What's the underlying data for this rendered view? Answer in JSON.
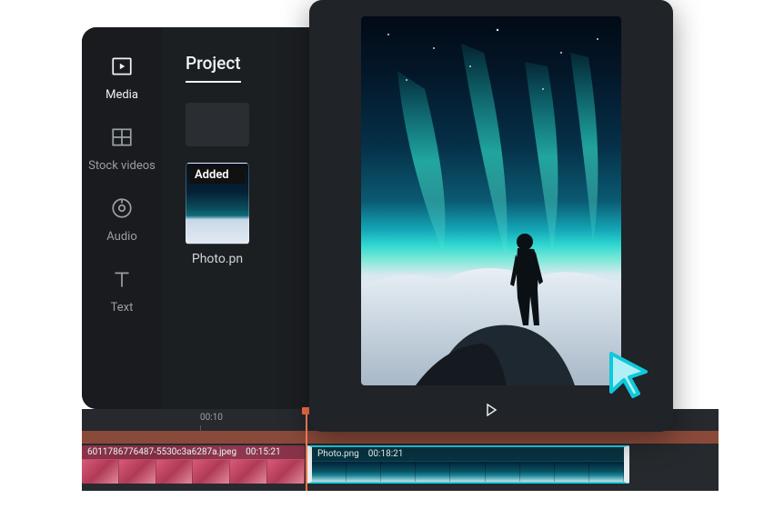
{
  "sidebar": {
    "items": [
      {
        "label": "Media",
        "icon": "media-icon",
        "active": true
      },
      {
        "label": "Stock videos",
        "icon": "stock-icon",
        "active": false
      },
      {
        "label": "Audio",
        "icon": "audio-icon",
        "active": false
      },
      {
        "label": "Text",
        "icon": "text-icon",
        "active": false
      }
    ]
  },
  "panel": {
    "tab_label": "Project",
    "added_badge": "Added",
    "thumb_filename": "Photo.pn"
  },
  "timeline": {
    "ticks": [
      "00:10"
    ],
    "clip_a": {
      "filename": "6011786776487-5530c3a6287a.jpeg",
      "duration": "00:15:21"
    },
    "clip_b": {
      "filename": "Photo.png",
      "duration": "00:18:21"
    }
  },
  "preview": {
    "play_label": "Play"
  },
  "colors": {
    "accent_teal": "#20d0e0",
    "accent_orange": "#ff7043",
    "panel_bg": "#1c1f22",
    "text_muted": "#9aa0a6"
  }
}
